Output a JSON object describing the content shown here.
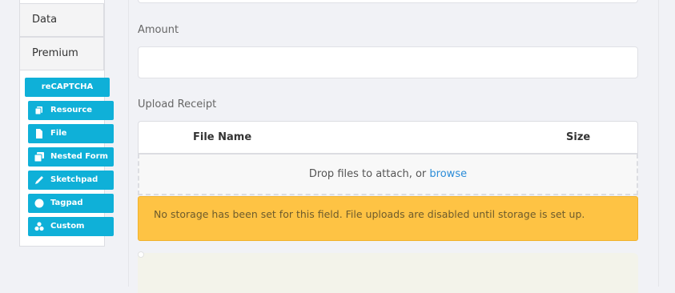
{
  "sidebar": {
    "groups": [
      {
        "label": "Data"
      },
      {
        "label": "Premium"
      }
    ],
    "premium_items": [
      {
        "label": "reCAPTCHA",
        "icon": ""
      },
      {
        "label": "Resource",
        "icon": "copy-icon"
      },
      {
        "label": "File",
        "icon": "file-icon"
      },
      {
        "label": "Nested Form",
        "icon": "nested-form-icon"
      },
      {
        "label": "Sketchpad",
        "icon": "pencil-icon"
      },
      {
        "label": "Tagpad",
        "icon": "circle-icon"
      },
      {
        "label": "Custom",
        "icon": "cubes-icon"
      }
    ]
  },
  "form": {
    "amount_label": "Amount",
    "amount_value": "",
    "upload_label": "Upload Receipt",
    "table_columns": [
      "File Name",
      "Size"
    ],
    "dropzone_text": "Drop files to attach, or",
    "dropzone_link": "browse",
    "alert_text": "No storage has been set for this field. File uploads are disabled until storage is set up."
  },
  "colors": {
    "accent": "#0fb0d8",
    "warning": "#fec344",
    "link": "#2b8cd8"
  }
}
